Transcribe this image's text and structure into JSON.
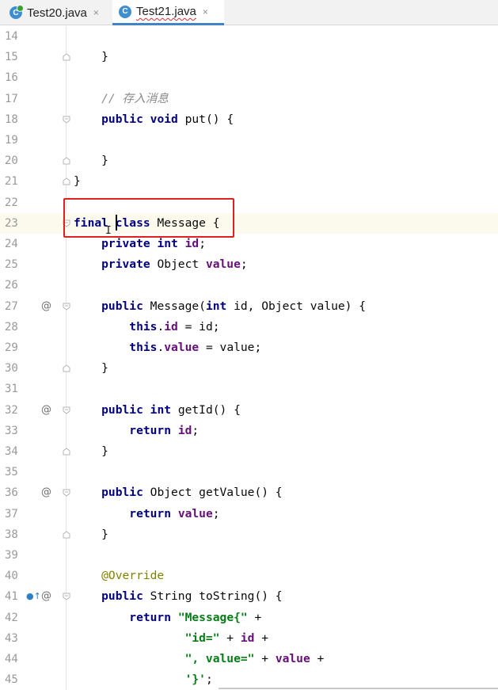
{
  "tabs": [
    {
      "label": "Test20.java",
      "icon": "java-class-icon",
      "close": "×"
    },
    {
      "label": "Test21.java",
      "icon": "java-class-icon",
      "close": "×",
      "active": true
    }
  ],
  "lines": [
    {
      "num": "14",
      "tokens": []
    },
    {
      "num": "15",
      "fold": "end",
      "tokens": [
        [
          "plain",
          "    }"
        ]
      ]
    },
    {
      "num": "16",
      "tokens": []
    },
    {
      "num": "17",
      "tokens": [
        [
          "cmt",
          "    // 存入消息"
        ]
      ]
    },
    {
      "num": "18",
      "fold": "start",
      "tokens": [
        [
          "kw",
          "    public"
        ],
        [
          "plain",
          " "
        ],
        [
          "kw",
          "void"
        ],
        [
          "plain",
          " put() {"
        ]
      ]
    },
    {
      "num": "19",
      "tokens": []
    },
    {
      "num": "20",
      "fold": "end",
      "tokens": [
        [
          "plain",
          "    }"
        ]
      ]
    },
    {
      "num": "21",
      "fold": "end",
      "tokens": [
        [
          "plain",
          "}"
        ]
      ]
    },
    {
      "num": "22",
      "tokens": []
    },
    {
      "num": "23",
      "fold": "start",
      "current": true,
      "tokens": [
        [
          "kw",
          "final"
        ],
        [
          "plain",
          " "
        ],
        [
          "kw",
          "class"
        ],
        [
          "plain",
          " Message {"
        ]
      ]
    },
    {
      "num": "24",
      "tokens": [
        [
          "kw",
          "    private"
        ],
        [
          "plain",
          " "
        ],
        [
          "kw",
          "int"
        ],
        [
          "plain",
          " "
        ],
        [
          "fld",
          "id"
        ],
        [
          "plain",
          ";"
        ]
      ]
    },
    {
      "num": "25",
      "tokens": [
        [
          "kw",
          "    private"
        ],
        [
          "plain",
          " Object "
        ],
        [
          "fld",
          "value"
        ],
        [
          "plain",
          ";"
        ]
      ]
    },
    {
      "num": "26",
      "tokens": []
    },
    {
      "num": "27",
      "marker": "@",
      "fold": "start",
      "tokens": [
        [
          "kw",
          "    public"
        ],
        [
          "plain",
          " Message("
        ],
        [
          "kw",
          "int"
        ],
        [
          "plain",
          " id, Object value) {"
        ]
      ]
    },
    {
      "num": "28",
      "tokens": [
        [
          "kw",
          "        this"
        ],
        [
          "plain",
          "."
        ],
        [
          "fld",
          "id"
        ],
        [
          "plain",
          " = id;"
        ]
      ]
    },
    {
      "num": "29",
      "tokens": [
        [
          "kw",
          "        this"
        ],
        [
          "plain",
          "."
        ],
        [
          "fld",
          "value"
        ],
        [
          "plain",
          " = value;"
        ]
      ]
    },
    {
      "num": "30",
      "fold": "end",
      "tokens": [
        [
          "plain",
          "    }"
        ]
      ]
    },
    {
      "num": "31",
      "tokens": []
    },
    {
      "num": "32",
      "marker": "@",
      "fold": "start",
      "tokens": [
        [
          "kw",
          "    public"
        ],
        [
          "plain",
          " "
        ],
        [
          "kw",
          "int"
        ],
        [
          "plain",
          " getId() {"
        ]
      ]
    },
    {
      "num": "33",
      "tokens": [
        [
          "kw",
          "        return"
        ],
        [
          "plain",
          " "
        ],
        [
          "fld",
          "id"
        ],
        [
          "plain",
          ";"
        ]
      ]
    },
    {
      "num": "34",
      "fold": "end",
      "tokens": [
        [
          "plain",
          "    }"
        ]
      ]
    },
    {
      "num": "35",
      "tokens": []
    },
    {
      "num": "36",
      "marker": "@",
      "fold": "start",
      "tokens": [
        [
          "kw",
          "    public"
        ],
        [
          "plain",
          " Object getValue() {"
        ]
      ]
    },
    {
      "num": "37",
      "tokens": [
        [
          "kw",
          "        return"
        ],
        [
          "plain",
          " "
        ],
        [
          "fld",
          "value"
        ],
        [
          "plain",
          ";"
        ]
      ]
    },
    {
      "num": "38",
      "fold": "end",
      "tokens": [
        [
          "plain",
          "    }"
        ]
      ]
    },
    {
      "num": "39",
      "tokens": []
    },
    {
      "num": "40",
      "tokens": [
        [
          "ann",
          "    @Override"
        ]
      ]
    },
    {
      "num": "41",
      "marker": "@",
      "marker2": "override-up-icon",
      "fold": "start",
      "tokens": [
        [
          "kw",
          "    public"
        ],
        [
          "plain",
          " String toString() {"
        ]
      ]
    },
    {
      "num": "42",
      "tokens": [
        [
          "kw",
          "        return"
        ],
        [
          "plain",
          " "
        ],
        [
          "str",
          "\"Message{\""
        ],
        [
          "plain",
          " +"
        ]
      ]
    },
    {
      "num": "43",
      "tokens": [
        [
          "str",
          "                \"id=\""
        ],
        [
          "plain",
          " + "
        ],
        [
          "fld",
          "id"
        ],
        [
          "plain",
          " +"
        ]
      ]
    },
    {
      "num": "44",
      "tokens": [
        [
          "str",
          "                \", value=\""
        ],
        [
          "plain",
          " + "
        ],
        [
          "fld",
          "value"
        ],
        [
          "plain",
          " +"
        ]
      ]
    },
    {
      "num": "45",
      "tokens": [
        [
          "str",
          "                '}'"
        ],
        [
          "plain",
          ";"
        ]
      ]
    }
  ],
  "colors": {
    "keyword": "#000080",
    "field": "#660e7a",
    "string": "#067d17",
    "comment": "#8c8c8c",
    "annotation": "#808000",
    "highlight": "#e0201e",
    "current_line": "#fcfaed"
  }
}
